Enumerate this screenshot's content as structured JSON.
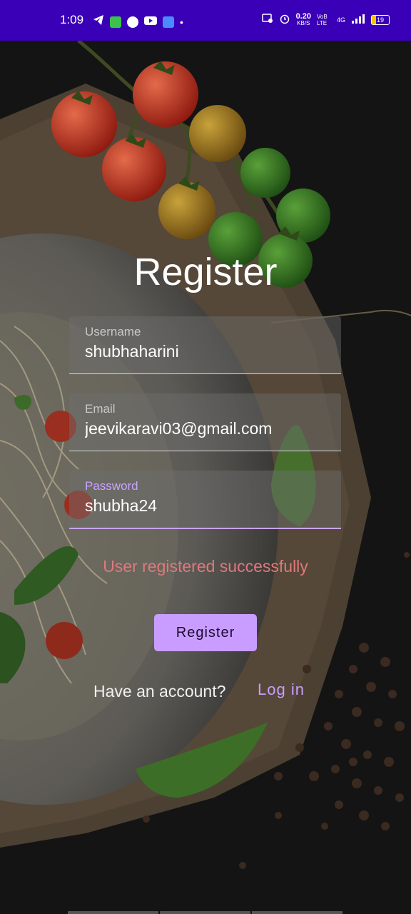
{
  "status_bar": {
    "time": "1:09",
    "data_speed": "0.20",
    "data_unit": "KB/S",
    "volte": "VoB LTE",
    "network": "4G",
    "battery": "19"
  },
  "title": "Register",
  "fields": {
    "username": {
      "label": "Username",
      "value": "shubhaharini"
    },
    "email": {
      "label": "Email",
      "value": "jeevikaravi03@gmail.com"
    },
    "password": {
      "label": "Password",
      "value": "shubha24"
    }
  },
  "message": "User registered successfully",
  "register_button": "Register",
  "have_account": "Have an account?",
  "login_link": "Log in",
  "colors": {
    "accent": "#c99dff",
    "status_bar": "#3a00b8",
    "error_text": "#e0787c"
  }
}
